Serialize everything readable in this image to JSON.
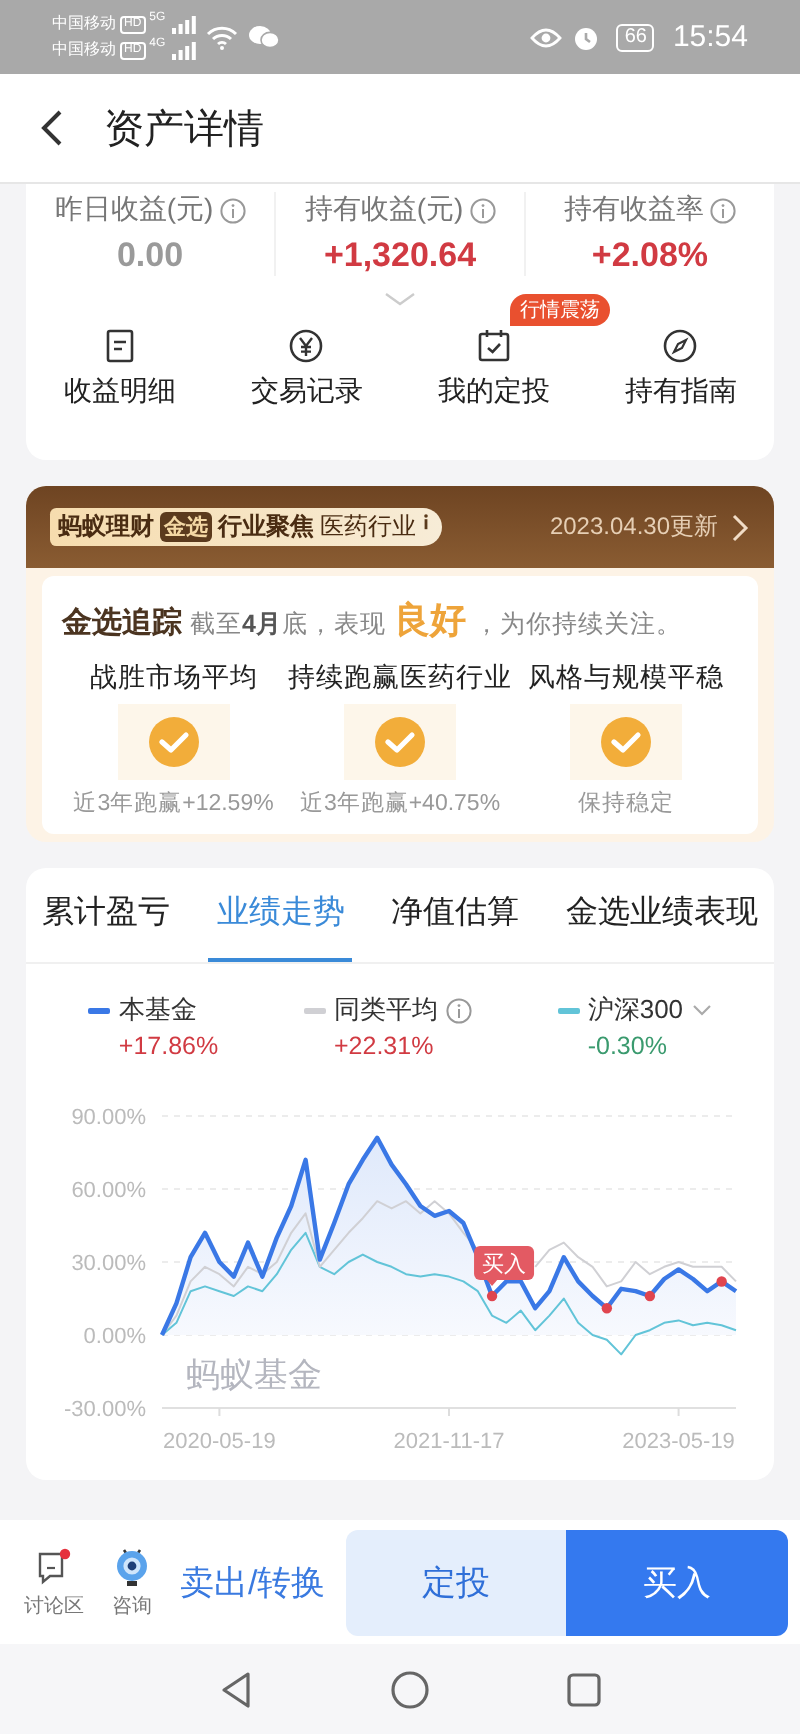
{
  "status_bar": {
    "carriers": [
      {
        "name": "中国移动",
        "badge": "HD",
        "network": "5G"
      },
      {
        "name": "中国移动",
        "badge": "HD",
        "network": "4G"
      }
    ],
    "battery": "66",
    "time": "15:54"
  },
  "header": {
    "title": "资产详情"
  },
  "summary": {
    "stats": [
      {
        "label": "昨日收益(元)",
        "value": "0.00",
        "kind": "flat"
      },
      {
        "label": "持有收益(元)",
        "value": "+1,320.64",
        "kind": "gain"
      },
      {
        "label": "持有收益率",
        "value": "+2.08%",
        "kind": "gain"
      }
    ],
    "actions": [
      {
        "label": "收益明细"
      },
      {
        "label": "交易记录"
      },
      {
        "label": "我的定投",
        "badge": "行情震荡"
      },
      {
        "label": "持有指南"
      }
    ]
  },
  "jinxuan": {
    "brand": "蚂蚁理财",
    "brand_tag": "金选",
    "category": "行业聚焦",
    "industry": "医药行业",
    "updated": "2023.04.30更新",
    "track_title": "金选追踪",
    "track_prefix": "截至**4月**底，表现",
    "track_rating": "良好",
    "track_suffix": "，为你持续关注。",
    "criteria": [
      {
        "title": "战胜市场平均",
        "checked": true,
        "note": "近3年跑赢+12.59%"
      },
      {
        "title": "持续跑赢医药行业",
        "checked": true,
        "note": "近3年跑赢+40.75%"
      },
      {
        "title": "风格与规模平稳",
        "checked": true,
        "note": "保持稳定"
      }
    ]
  },
  "performance": {
    "tabs": [
      {
        "label": "累计盈亏",
        "selected": false
      },
      {
        "label": "业绩走势",
        "selected": true
      },
      {
        "label": "净值估算",
        "selected": false
      },
      {
        "label": "金选业绩表现",
        "selected": false
      }
    ],
    "legend": [
      {
        "change": "+17.86%",
        "kind": "gain",
        "has_info": false,
        "has_menu": false
      },
      {
        "change": "+22.31%",
        "kind": "gain",
        "has_info": true,
        "has_menu": false
      },
      {
        "change": "-0.30%",
        "kind": "loss",
        "has_info": false,
        "has_menu": true
      }
    ],
    "watermark": "蚂蚁基金",
    "buy_marker": {
      "label": "买入"
    },
    "chart_data": {
      "type": "line",
      "grid": true,
      "categories": [
        null,
        null,
        null,
        null,
        "2020-05-19",
        null,
        null,
        null,
        null,
        null,
        null,
        null,
        null,
        null,
        null,
        null,
        null,
        null,
        null,
        null,
        "2021-11-17",
        null,
        null,
        null,
        null,
        null,
        null,
        null,
        null,
        null,
        null,
        null,
        null,
        null,
        null,
        null,
        "2023-05-19",
        null,
        null,
        null,
        null
      ],
      "yticks": [
        {
          "value": 90,
          "label": "90.00%"
        },
        {
          "value": 60,
          "label": "60.00%"
        },
        {
          "value": 30,
          "label": "30.00%"
        },
        {
          "value": 0,
          "label": "0.00%"
        },
        {
          "value": -30,
          "label": "-30.00%"
        }
      ],
      "ylim": [
        -30,
        90
      ],
      "series": [
        {
          "name": "本基金",
          "type": "area",
          "color": "#3a78e6",
          "values": [
            0,
            13,
            32,
            42,
            30,
            24,
            38,
            24,
            40,
            53,
            72,
            31,
            46,
            62,
            72,
            81,
            70,
            62,
            53,
            49,
            51,
            46,
            32,
            16,
            22,
            22,
            11,
            18,
            32,
            22,
            16,
            11,
            19,
            18,
            16,
            23,
            27,
            23,
            18,
            22,
            18
          ]
        },
        {
          "name": "同类平均",
          "color": "#d0d0d4",
          "values": [
            0,
            8,
            22,
            28,
            25,
            20,
            28,
            25,
            30,
            42,
            50,
            28,
            35,
            42,
            48,
            55,
            52,
            55,
            50,
            55,
            50,
            42,
            35,
            null,
            null,
            null,
            28,
            35,
            38,
            32,
            28,
            20,
            22,
            30,
            25,
            28,
            30,
            28,
            28,
            28,
            22
          ]
        },
        {
          "name": "沪深300",
          "color": "#62c4d8",
          "values": [
            0,
            5,
            18,
            20,
            18,
            16,
            20,
            18,
            25,
            35,
            42,
            28,
            25,
            30,
            33,
            30,
            28,
            25,
            24,
            25,
            24,
            22,
            18,
            8,
            5,
            10,
            2,
            8,
            15,
            5,
            0,
            -2,
            -8,
            0,
            2,
            5,
            6,
            4,
            5,
            4,
            2
          ]
        }
      ]
    }
  },
  "bottom_bar": {
    "links": [
      {
        "label": "讨论区",
        "unread": true
      },
      {
        "label": "咨询",
        "unread": false
      }
    ],
    "sell": "卖出/转换",
    "buttons": [
      {
        "label": "定投",
        "kind": "secondary"
      },
      {
        "label": "买入",
        "kind": "primary"
      }
    ]
  }
}
